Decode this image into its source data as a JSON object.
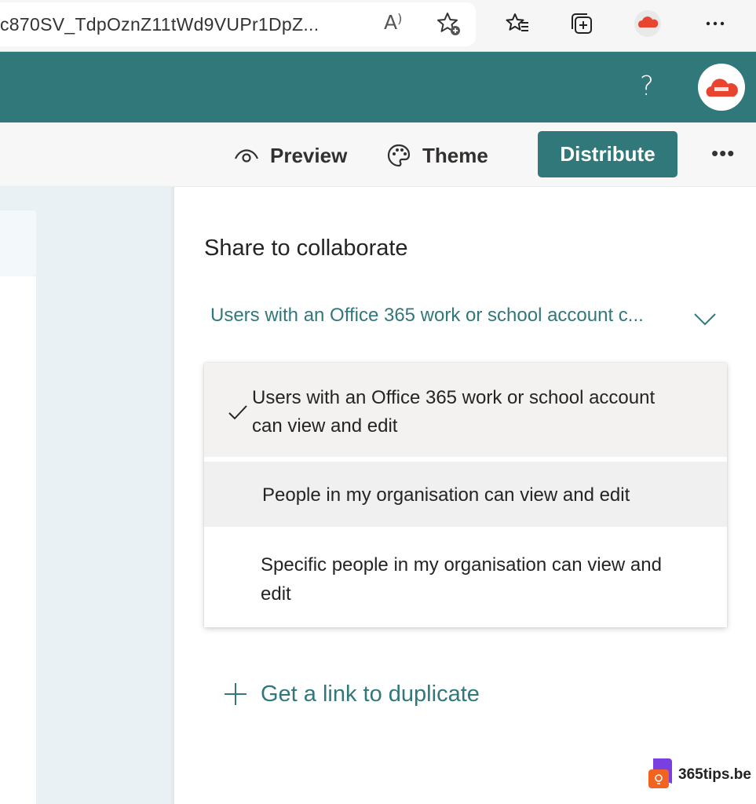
{
  "browser": {
    "url": "c870SV_TdpOznZ11tWd9VUPr1DpZ...",
    "read_aloud": "A",
    "icons": [
      "read-aloud-icon",
      "add-favorite-icon",
      "favorites-icon",
      "collections-icon",
      "office-profile-icon",
      "more-icon"
    ]
  },
  "header": {
    "help": "?",
    "avatar_icon": "office-cloud-icon"
  },
  "commands": {
    "preview": "Preview",
    "theme": "Theme",
    "distribute": "Distribute",
    "more": "•••"
  },
  "share": {
    "title": "Share to collaborate",
    "selected": "Users with an Office 365 work or school account c...",
    "options": [
      {
        "label": "Users with an Office 365 work or school account can view and edit",
        "line1": "Users with an Office 365 work or school account",
        "line2": "can view and edit",
        "checked": true
      },
      {
        "label": "People in my organisation can view and edit",
        "line1": "People in my organisation can view and edit",
        "checked": false
      },
      {
        "label": "Specific people in my organisation can view and edit",
        "line1": "Specific people in my organisation can view and",
        "line2": "edit",
        "checked": false
      }
    ],
    "duplicate": "Get a link to duplicate"
  },
  "brand": {
    "name": "365tips.be"
  },
  "colors": {
    "accent": "#31787a",
    "canvas": "#eaf1f4"
  }
}
